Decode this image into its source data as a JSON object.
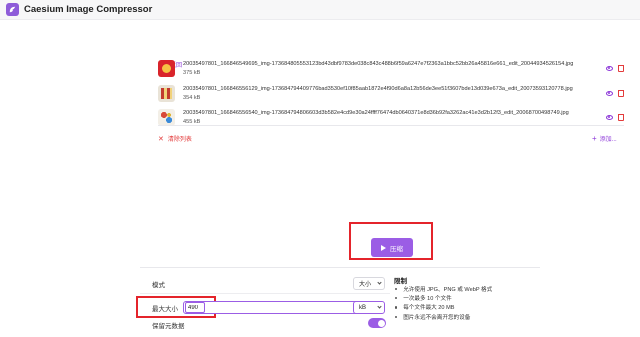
{
  "app": {
    "title": "Caesium Image Compressor"
  },
  "nav": {
    "back_label": "返回"
  },
  "files": [
    {
      "name": "20035497801_166846549695_img-173684805553123bd43dbf9783de038c843c488b6f59a6247e7f2363a1bbc52bb26a45816e661_edit_20044934526154.jpg",
      "size": "375 kB"
    },
    {
      "name": "20035497801_166846556129_img-173684794409776bad3530ef10f85aab1872e4f90d6a8a12b56de3ee51f3607bde13d039e673a_edit_20073593120778.jpg",
      "size": "354 kB"
    },
    {
      "name": "20035497801_166846556540_img-173684794806603d3b582e4cd9e30a24ffff76474db0640371e8d36b92fa3262ac41e3d2b12f3_edit_20068700498749.jpg",
      "size": "455 kB"
    }
  ],
  "list_actions": {
    "clear_label": "清除列表",
    "add_label": "添加..."
  },
  "compress": {
    "label": "压缩"
  },
  "settings": {
    "mode_label": "模式",
    "mode_value": "大小",
    "max_size_label": "最大大小",
    "max_size_value": "490",
    "unit_value": "kB",
    "keep_metadata_label": "保留元数据"
  },
  "limits": {
    "title": "限制",
    "items": [
      "允许使用 JPG、PNG 或 WebP 格式",
      "一次最多 10 个文件",
      "每个文件最大 20 MB",
      "图片永远不会离开您的设备"
    ]
  },
  "colors": {
    "accent": "#9b5de5",
    "danger": "#e33b3b",
    "highlight": "#e4242b"
  }
}
